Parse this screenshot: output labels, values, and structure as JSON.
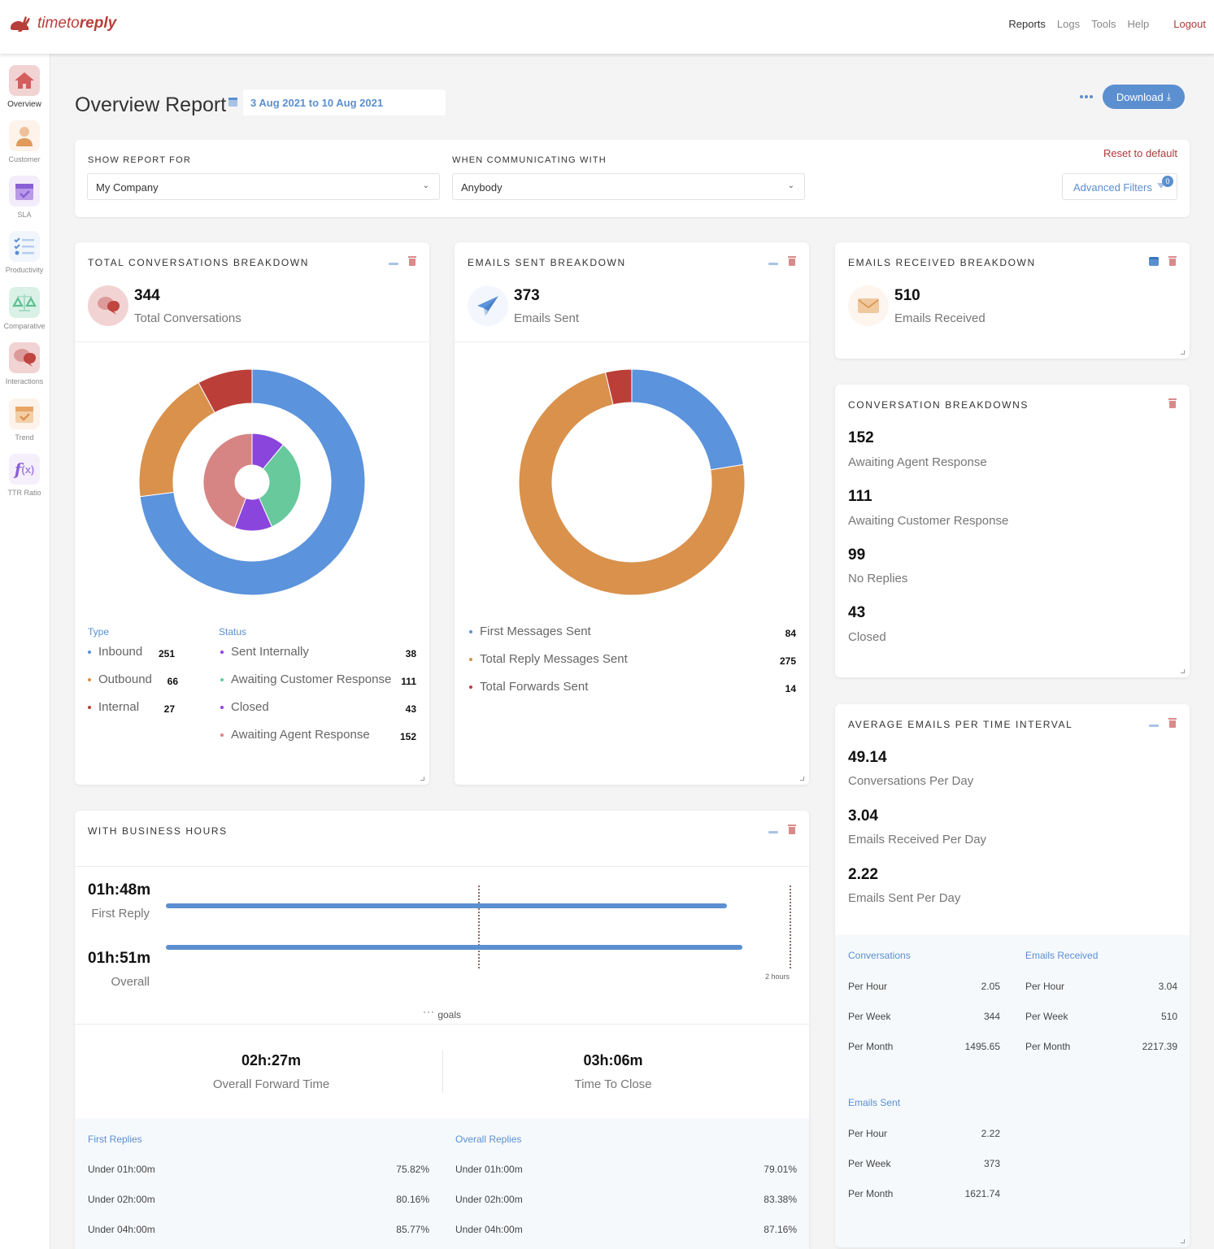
{
  "app": {
    "brand_part1": "timeto",
    "brand_part2": "reply"
  },
  "topnav": {
    "items": [
      {
        "label": "Reports",
        "active": true
      },
      {
        "label": "Logs"
      },
      {
        "label": "Tools"
      },
      {
        "label": "Help"
      }
    ],
    "logout": "Logout"
  },
  "sidebar": {
    "items": [
      {
        "label": "Overview",
        "icon": "house-icon",
        "active": true
      },
      {
        "label": "Customer",
        "icon": "person-icon"
      },
      {
        "label": "SLA",
        "icon": "calendar-check-icon"
      },
      {
        "label": "Productivity",
        "icon": "checklist-icon"
      },
      {
        "label": "Comparative",
        "icon": "scale-icon"
      },
      {
        "label": "Interactions",
        "icon": "chat-bubbles-icon"
      },
      {
        "label": "Trend",
        "icon": "calendar-check-icon"
      },
      {
        "label": "TTR Ratio",
        "icon": "function-icon"
      }
    ]
  },
  "header": {
    "title": "Overview Report",
    "date_range": "3 Aug 2021 to 10 Aug 2021",
    "download_label": "Download"
  },
  "filters": {
    "show_report_for_label": "SHOW REPORT FOR",
    "show_report_for_value": "My Company",
    "communicating_with_label": "WHEN COMMUNICATING WITH",
    "communicating_with_value": "Anybody",
    "reset_label": "Reset to default",
    "advanced_label": "Advanced Filters",
    "advanced_count": "0"
  },
  "total_conversations": {
    "title": "TOTAL CONVERSATIONS BREAKDOWN",
    "value": "344",
    "label": "Total Conversations",
    "type_header": "Type",
    "status_header": "Status",
    "types": [
      {
        "label": "Inbound",
        "value": "251",
        "color": "#5b93dc"
      },
      {
        "label": "Outbound",
        "value": "66",
        "color": "#d9914c"
      },
      {
        "label": "Internal",
        "value": "27",
        "color": "#bb3f38"
      }
    ],
    "statuses": [
      {
        "label": "Sent Internally",
        "value": "38",
        "color": "#8a45dc"
      },
      {
        "label": "Awaiting Customer Response",
        "value": "111",
        "color": "#67c99c"
      },
      {
        "label": "Closed",
        "value": "43",
        "color": "#8a45dc"
      },
      {
        "label": "Awaiting Agent Response",
        "value": "152",
        "color": "#d78484"
      }
    ]
  },
  "emails_sent": {
    "title": "EMAILS SENT BREAKDOWN",
    "value": "373",
    "label": "Emails Sent",
    "items": [
      {
        "label": "First Messages Sent",
        "value": "84",
        "color": "#5b93dc"
      },
      {
        "label": "Total Reply Messages Sent",
        "value": "275",
        "color": "#d9914c"
      },
      {
        "label": "Total Forwards Sent",
        "value": "14",
        "color": "#bb3f38"
      }
    ]
  },
  "emails_received": {
    "title": "EMAILS RECEIVED BREAKDOWN",
    "value": "510",
    "label": "Emails Received"
  },
  "conversation_breakdowns": {
    "title": "CONVERSATION BREAKDOWNS",
    "items": [
      {
        "value": "152",
        "label": "Awaiting Agent Response"
      },
      {
        "value": "111",
        "label": "Awaiting Customer Response"
      },
      {
        "value": "99",
        "label": "No Replies"
      },
      {
        "value": "43",
        "label": "Closed"
      }
    ]
  },
  "average_emails": {
    "title": "AVERAGE EMAILS PER TIME INTERVAL",
    "items": [
      {
        "value": "49.14",
        "label": "Conversations Per Day"
      },
      {
        "value": "3.04",
        "label": "Emails Received Per Day"
      },
      {
        "value": "2.22",
        "label": "Emails Sent Per Day"
      }
    ],
    "groups": [
      {
        "header": "Conversations",
        "rows": [
          {
            "label": "Per Hour",
            "value": "2.05"
          },
          {
            "label": "Per Week",
            "value": "344"
          },
          {
            "label": "Per Month",
            "value": "1495.65"
          }
        ]
      },
      {
        "header": "Emails Received",
        "rows": [
          {
            "label": "Per Hour",
            "value": "3.04"
          },
          {
            "label": "Per Week",
            "value": "510"
          },
          {
            "label": "Per Month",
            "value": "2217.39"
          }
        ]
      },
      {
        "header": "Emails Sent",
        "rows": [
          {
            "label": "Per Hour",
            "value": "2.22"
          },
          {
            "label": "Per Week",
            "value": "373"
          },
          {
            "label": "Per Month",
            "value": "1621.74"
          }
        ]
      }
    ]
  },
  "business_hours": {
    "title": "WITH BUSINESS HOURS",
    "first_reply_time": "01h:48m",
    "first_reply_label": "First Reply",
    "first_reply_minutes": 108,
    "overall_time": "01h:51m",
    "overall_label": "Overall",
    "overall_minutes": 111,
    "axis_max_label": "2 hours",
    "axis_max_minutes": 120,
    "goal_minutes": 60,
    "goals_legend": "goals",
    "forward_time": "02h:27m",
    "forward_label": "Overall Forward Time",
    "close_time": "03h:06m",
    "close_label": "Time To Close",
    "first_replies": {
      "header": "First Replies",
      "rows": [
        {
          "label": "Under 01h:00m",
          "value": "75.82%"
        },
        {
          "label": "Under 02h:00m",
          "value": "80.16%"
        },
        {
          "label": "Under 04h:00m",
          "value": "85.77%"
        }
      ]
    },
    "overall_replies": {
      "header": "Overall Replies",
      "rows": [
        {
          "label": "Under 01h:00m",
          "value": "79.01%"
        },
        {
          "label": "Under 02h:00m",
          "value": "83.38%"
        },
        {
          "label": "Under 04h:00m",
          "value": "87.16%"
        }
      ]
    }
  },
  "chart_data": [
    {
      "type": "pie",
      "title": "Conversation Type",
      "categories": [
        "Inbound",
        "Outbound",
        "Internal"
      ],
      "values": [
        251,
        66,
        27
      ]
    },
    {
      "type": "pie",
      "title": "Conversation Status",
      "categories": [
        "Sent Internally",
        "Awaiting Customer Response",
        "Closed",
        "Awaiting Agent Response"
      ],
      "values": [
        38,
        111,
        43,
        152
      ]
    },
    {
      "type": "pie",
      "title": "Emails Sent",
      "categories": [
        "First Messages Sent",
        "Total Reply Messages Sent",
        "Total Forwards Sent"
      ],
      "values": [
        84,
        275,
        14
      ]
    }
  ]
}
